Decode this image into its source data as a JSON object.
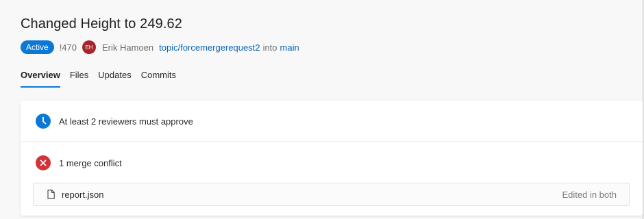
{
  "header": {
    "title": "Changed Height to 249.62",
    "status_badge": "Active",
    "pr_id": "!470",
    "author_initials": "EH",
    "author_name": "Erik Hamoen",
    "source_branch": "topic/forcemergerequest2",
    "into_text": "into",
    "target_branch": "main"
  },
  "tabs": [
    {
      "label": "Overview",
      "active": true
    },
    {
      "label": "Files",
      "active": false
    },
    {
      "label": "Updates",
      "active": false
    },
    {
      "label": "Commits",
      "active": false
    }
  ],
  "overview": {
    "policy_text": "At least 2 reviewers must approve",
    "conflict_text": "1 merge conflict",
    "conflict_file": {
      "name": "report.json",
      "status": "Edited in both"
    }
  },
  "colors": {
    "accent": "#0a78d4",
    "error": "#d13438",
    "avatar": "#a4262c",
    "link": "#0b65b8"
  },
  "icons": {
    "policy": "clock-icon",
    "conflict": "error-icon",
    "file": "file-icon"
  }
}
